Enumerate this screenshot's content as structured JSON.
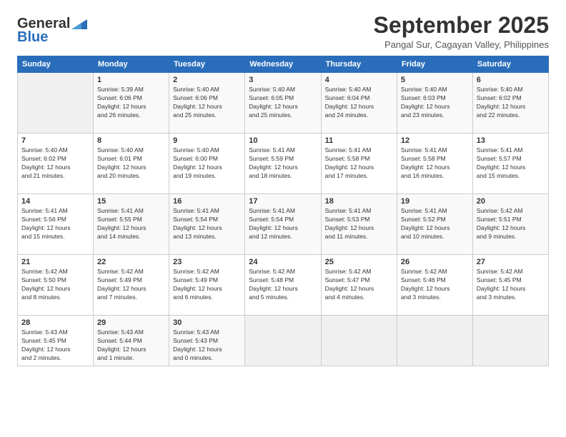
{
  "logo": {
    "line1": "General",
    "line2": "Blue"
  },
  "title": "September 2025",
  "subtitle": "Pangal Sur, Cagayan Valley, Philippines",
  "days_header": [
    "Sunday",
    "Monday",
    "Tuesday",
    "Wednesday",
    "Thursday",
    "Friday",
    "Saturday"
  ],
  "weeks": [
    [
      {
        "day": "",
        "info": ""
      },
      {
        "day": "1",
        "info": "Sunrise: 5:39 AM\nSunset: 6:06 PM\nDaylight: 12 hours\nand 26 minutes."
      },
      {
        "day": "2",
        "info": "Sunrise: 5:40 AM\nSunset: 6:06 PM\nDaylight: 12 hours\nand 25 minutes."
      },
      {
        "day": "3",
        "info": "Sunrise: 5:40 AM\nSunset: 6:05 PM\nDaylight: 12 hours\nand 25 minutes."
      },
      {
        "day": "4",
        "info": "Sunrise: 5:40 AM\nSunset: 6:04 PM\nDaylight: 12 hours\nand 24 minutes."
      },
      {
        "day": "5",
        "info": "Sunrise: 5:40 AM\nSunset: 6:03 PM\nDaylight: 12 hours\nand 23 minutes."
      },
      {
        "day": "6",
        "info": "Sunrise: 5:40 AM\nSunset: 6:02 PM\nDaylight: 12 hours\nand 22 minutes."
      }
    ],
    [
      {
        "day": "7",
        "info": "Sunrise: 5:40 AM\nSunset: 6:02 PM\nDaylight: 12 hours\nand 21 minutes."
      },
      {
        "day": "8",
        "info": "Sunrise: 5:40 AM\nSunset: 6:01 PM\nDaylight: 12 hours\nand 20 minutes."
      },
      {
        "day": "9",
        "info": "Sunrise: 5:40 AM\nSunset: 6:00 PM\nDaylight: 12 hours\nand 19 minutes."
      },
      {
        "day": "10",
        "info": "Sunrise: 5:41 AM\nSunset: 5:59 PM\nDaylight: 12 hours\nand 18 minutes."
      },
      {
        "day": "11",
        "info": "Sunrise: 5:41 AM\nSunset: 5:58 PM\nDaylight: 12 hours\nand 17 minutes."
      },
      {
        "day": "12",
        "info": "Sunrise: 5:41 AM\nSunset: 5:58 PM\nDaylight: 12 hours\nand 16 minutes."
      },
      {
        "day": "13",
        "info": "Sunrise: 5:41 AM\nSunset: 5:57 PM\nDaylight: 12 hours\nand 15 minutes."
      }
    ],
    [
      {
        "day": "14",
        "info": "Sunrise: 5:41 AM\nSunset: 5:56 PM\nDaylight: 12 hours\nand 15 minutes."
      },
      {
        "day": "15",
        "info": "Sunrise: 5:41 AM\nSunset: 5:55 PM\nDaylight: 12 hours\nand 14 minutes."
      },
      {
        "day": "16",
        "info": "Sunrise: 5:41 AM\nSunset: 5:54 PM\nDaylight: 12 hours\nand 13 minutes."
      },
      {
        "day": "17",
        "info": "Sunrise: 5:41 AM\nSunset: 5:54 PM\nDaylight: 12 hours\nand 12 minutes."
      },
      {
        "day": "18",
        "info": "Sunrise: 5:41 AM\nSunset: 5:53 PM\nDaylight: 12 hours\nand 11 minutes."
      },
      {
        "day": "19",
        "info": "Sunrise: 5:41 AM\nSunset: 5:52 PM\nDaylight: 12 hours\nand 10 minutes."
      },
      {
        "day": "20",
        "info": "Sunrise: 5:42 AM\nSunset: 5:51 PM\nDaylight: 12 hours\nand 9 minutes."
      }
    ],
    [
      {
        "day": "21",
        "info": "Sunrise: 5:42 AM\nSunset: 5:50 PM\nDaylight: 12 hours\nand 8 minutes."
      },
      {
        "day": "22",
        "info": "Sunrise: 5:42 AM\nSunset: 5:49 PM\nDaylight: 12 hours\nand 7 minutes."
      },
      {
        "day": "23",
        "info": "Sunrise: 5:42 AM\nSunset: 5:49 PM\nDaylight: 12 hours\nand 6 minutes."
      },
      {
        "day": "24",
        "info": "Sunrise: 5:42 AM\nSunset: 5:48 PM\nDaylight: 12 hours\nand 5 minutes."
      },
      {
        "day": "25",
        "info": "Sunrise: 5:42 AM\nSunset: 5:47 PM\nDaylight: 12 hours\nand 4 minutes."
      },
      {
        "day": "26",
        "info": "Sunrise: 5:42 AM\nSunset: 5:46 PM\nDaylight: 12 hours\nand 3 minutes."
      },
      {
        "day": "27",
        "info": "Sunrise: 5:42 AM\nSunset: 5:45 PM\nDaylight: 12 hours\nand 3 minutes."
      }
    ],
    [
      {
        "day": "28",
        "info": "Sunrise: 5:43 AM\nSunset: 5:45 PM\nDaylight: 12 hours\nand 2 minutes."
      },
      {
        "day": "29",
        "info": "Sunrise: 5:43 AM\nSunset: 5:44 PM\nDaylight: 12 hours\nand 1 minute."
      },
      {
        "day": "30",
        "info": "Sunrise: 5:43 AM\nSunset: 5:43 PM\nDaylight: 12 hours\nand 0 minutes."
      },
      {
        "day": "",
        "info": ""
      },
      {
        "day": "",
        "info": ""
      },
      {
        "day": "",
        "info": ""
      },
      {
        "day": "",
        "info": ""
      }
    ]
  ]
}
